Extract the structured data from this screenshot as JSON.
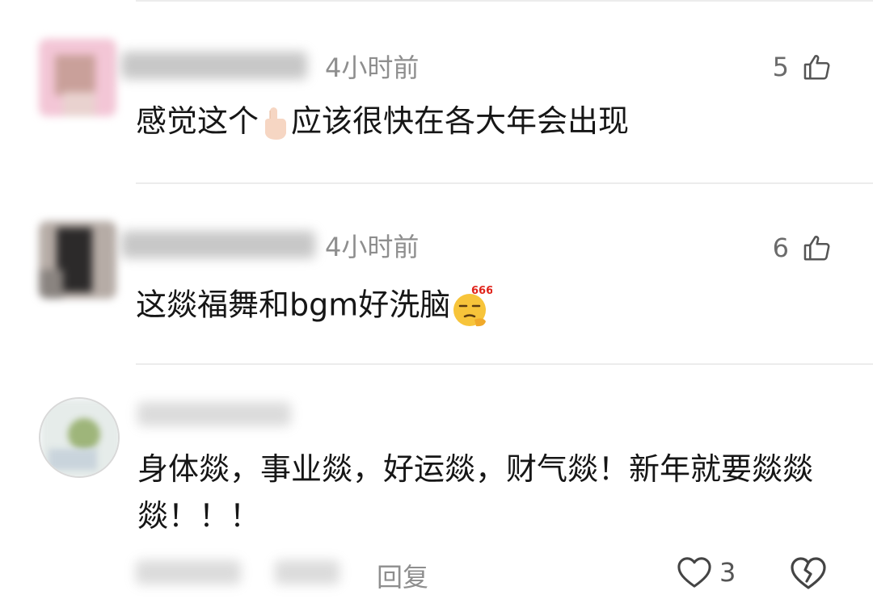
{
  "comments": [
    {
      "time": "4小时前",
      "likes": "5",
      "text_before": "感觉这个",
      "text_after": "应该很快在各大年会出现",
      "inline_emoji": "pointing-finger-icon"
    },
    {
      "time": "4小时前",
      "likes": "6",
      "text": "这燚福舞和bgm好洗脑",
      "inline_emoji": "666-thinking-emoji-icon",
      "emoji_badge": "666"
    },
    {
      "text": "身体燚，事业燚，好运燚，财气燚！新年就要燚燚燚！！！",
      "reply_label": "回复",
      "likes": "3"
    }
  ],
  "icons": [
    "thumb-up-icon",
    "heart-icon",
    "broken-heart-icon"
  ],
  "colors": {
    "meta_gray": "#8e8e8e",
    "text": "#161616",
    "divider": "#ececec"
  }
}
